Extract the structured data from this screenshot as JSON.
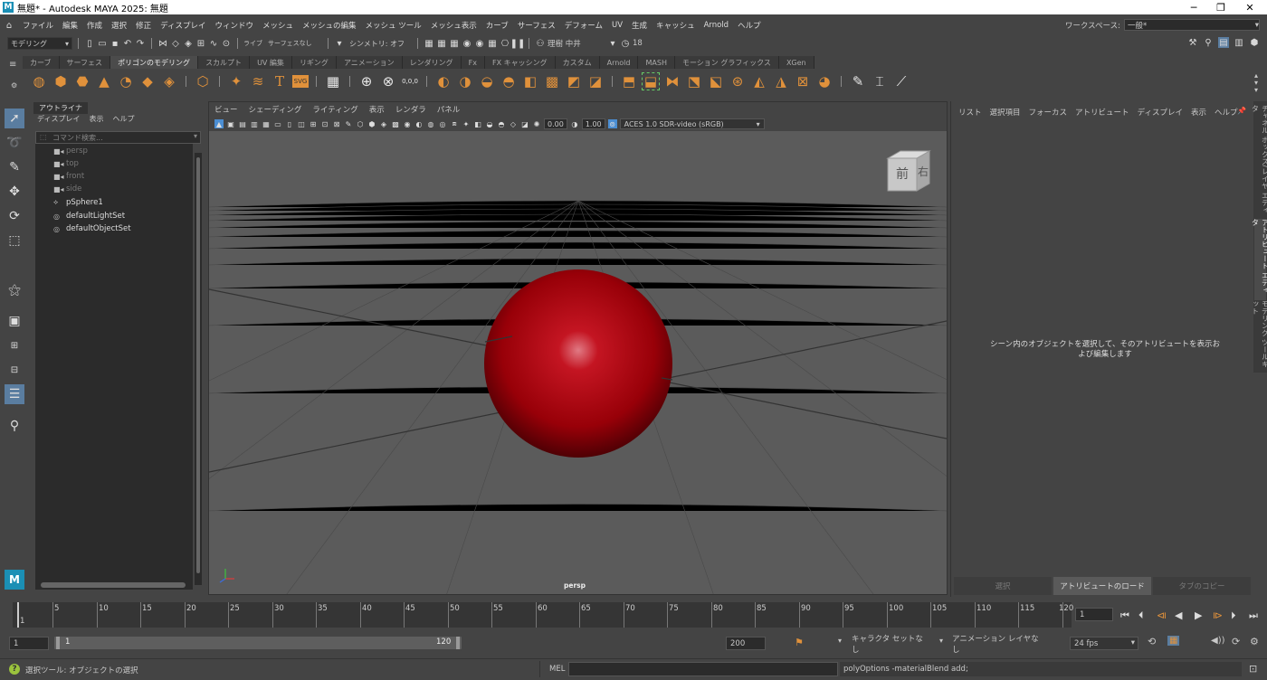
{
  "titlebar": {
    "app_icon": "M",
    "title": "無題* - Autodesk MAYA 2025: 無題"
  },
  "menubar": {
    "home_icon": "house-icon",
    "items": [
      "ファイル",
      "編集",
      "作成",
      "選択",
      "修正",
      "ディスプレイ",
      "ウィンドウ",
      "メッシュ",
      "メッシュの編集",
      "メッシュ ツール",
      "メッシュ表示",
      "カーブ",
      "サーフェス",
      "デフォーム",
      "UV",
      "生成",
      "キャッシュ",
      "Arnold",
      "ヘルプ"
    ],
    "workspace_label": "ワークスペース:",
    "workspace_value": "一般*"
  },
  "statusline": {
    "mode": "モデリング",
    "live": "ライブ",
    "live_value": "サーフェスなし",
    "symmetry": "シンメトリ: オフ",
    "user": "理樹 中井",
    "notif_count": "18"
  },
  "shelf": {
    "tabs": [
      "カーブ",
      "サーフェス",
      "ポリゴンのモデリング",
      "スカルプト",
      "UV 編集",
      "リギング",
      "アニメーション",
      "レンダリング",
      "Fx",
      "FX キャッシング",
      "カスタム",
      "Arnold",
      "MASH",
      "モーション グラフィックス",
      "XGen"
    ],
    "active_tab": "ポリゴンのモデリング",
    "text_icon": "T",
    "svg_icon": "SVG",
    "xyz_label": "0,0,0"
  },
  "outliner": {
    "tab": "アウトライナ",
    "menu": [
      "ディスプレイ",
      "表示",
      "ヘルプ"
    ],
    "search_placeholder": "コマンド検索...",
    "items": [
      {
        "label": "persp",
        "icon": "camera-icon",
        "dim": true
      },
      {
        "label": "top",
        "icon": "camera-icon",
        "dim": true
      },
      {
        "label": "front",
        "icon": "camera-icon",
        "dim": true
      },
      {
        "label": "side",
        "icon": "camera-icon",
        "dim": true
      },
      {
        "label": "pSphere1",
        "icon": "mesh-icon",
        "dim": false
      },
      {
        "label": "defaultLightSet",
        "icon": "set-icon",
        "dim": false
      },
      {
        "label": "defaultObjectSet",
        "icon": "set-icon",
        "dim": false
      }
    ]
  },
  "viewport": {
    "menu": [
      "ビュー",
      "シェーディング",
      "ライティング",
      "表示",
      "レンダラ",
      "パネル"
    ],
    "exposure": "0.00",
    "gamma": "1.00",
    "color_space": "ACES 1.0 SDR-video (sRGB)",
    "camera_label": "persp",
    "viewcube_front": "前",
    "viewcube_right": "右"
  },
  "attribute_editor": {
    "menu": [
      "リスト",
      "選択項目",
      "フォーカス",
      "アトリビュート",
      "ディスプレイ",
      "表示",
      "ヘルプ"
    ],
    "message": "シーン内のオブジェクトを選択して、そのアトリビュートを表示および編集します",
    "buttons": [
      "選択",
      "アトリビュートのロード",
      "タブのコピー"
    ]
  },
  "side_tabs": [
    "チャネル ボックス/レイヤ エディタ",
    "アトリビュート エディタ",
    "モデリング ツールキット"
  ],
  "timeslider": {
    "ticks": [
      "1",
      "5",
      "10",
      "15",
      "20",
      "25",
      "30",
      "35",
      "40",
      "45",
      "50",
      "55",
      "60",
      "65",
      "70",
      "75",
      "80",
      "85",
      "90",
      "95",
      "100",
      "105",
      "110",
      "115",
      "120"
    ],
    "current_frame": "1"
  },
  "range": {
    "start": "1",
    "inner_start": "1",
    "inner_end": "120",
    "end": "200",
    "character_set": "キャラクタ セットなし",
    "anim_layer": "アニメーション レイヤなし",
    "fps": "24 fps"
  },
  "helpline": {
    "help_text": "選択ツール: オブジェクトの選択",
    "lang": "MEL",
    "output": "polyOptions -materialBlend add;"
  },
  "colors": {
    "sphere": "#b0000a",
    "accent_orange": "#e0913b",
    "accent_blue": "#1b8fb5"
  }
}
